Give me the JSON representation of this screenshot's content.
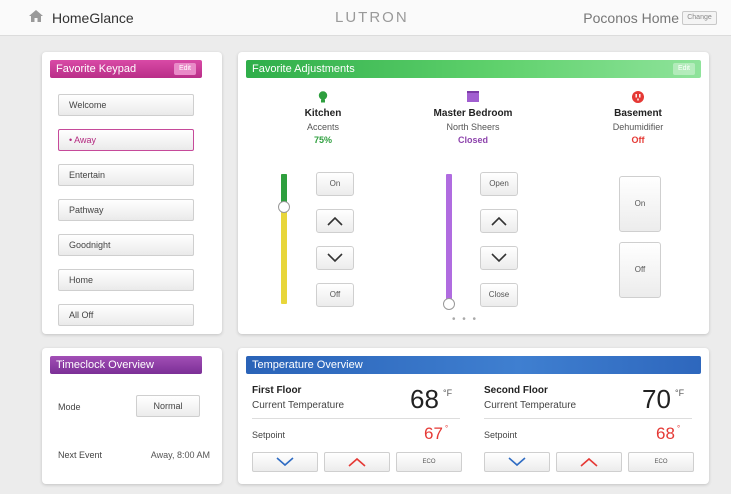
{
  "header": {
    "app_name": "HomeGlance",
    "brand": "LUTRON",
    "site_name": "Poconos Home",
    "change_label": "Change"
  },
  "keypad": {
    "title": "Favorite Keypad",
    "edit_label": "Edit",
    "buttons": [
      {
        "label": "Welcome",
        "active": false
      },
      {
        "label": "• Away",
        "active": true
      },
      {
        "label": "Entertain",
        "active": false
      },
      {
        "label": "Pathway",
        "active": false
      },
      {
        "label": "Goodnight",
        "active": false
      },
      {
        "label": "Home",
        "active": false
      },
      {
        "label": "All Off",
        "active": false
      }
    ]
  },
  "favorites": {
    "title": "Favorite Adjustments",
    "edit_label": "Edit",
    "devices": [
      {
        "name": "Kitchen",
        "sub": "Accents",
        "value": "75%",
        "value_color": "#2e9f3e",
        "icon": "light-bulb-icon",
        "icon_color": "#2e9f3e",
        "level": 0.75,
        "btn_top": "On",
        "btn_bottom": "Off"
      },
      {
        "name": "Master Bedroom",
        "sub": "North Sheers",
        "value": "Closed",
        "value_color": "#8e44ad",
        "icon": "shade-icon",
        "icon_color": "#a15ed0",
        "level": 0.0,
        "btn_top": "Open",
        "btn_bottom": "Close"
      },
      {
        "name": "Basement",
        "sub": "Dehumidifier",
        "value": "Off",
        "value_color": "#e53935",
        "icon": "power-outlet-icon",
        "icon_color": "#e53935",
        "btn_top": "On",
        "btn_bottom": "Off"
      }
    ]
  },
  "timeclock": {
    "title": "Timeclock Overview",
    "mode_label": "Mode",
    "mode_value": "Normal",
    "next_label": "Next Event",
    "next_value": "Away, 8:00 AM"
  },
  "temperature": {
    "title": "Temperature Overview",
    "eco_label": "ECO",
    "zones": [
      {
        "name": "First Floor",
        "current_label": "Current Temperature",
        "current": "68",
        "unit": "°F",
        "setpoint_label": "Setpoint",
        "setpoint": "67",
        "setpoint_unit": "°"
      },
      {
        "name": "Second Floor",
        "current_label": "Current Temperature",
        "current": "70",
        "unit": "°F",
        "setpoint_label": "Setpoint",
        "setpoint": "68",
        "setpoint_unit": "°"
      }
    ]
  },
  "colors": {
    "keypad_accent": "#c23a90",
    "favorites_accent": "#3bb54f",
    "timeclock_accent": "#8b3aa6",
    "temperature_accent": "#2f6cc3"
  }
}
